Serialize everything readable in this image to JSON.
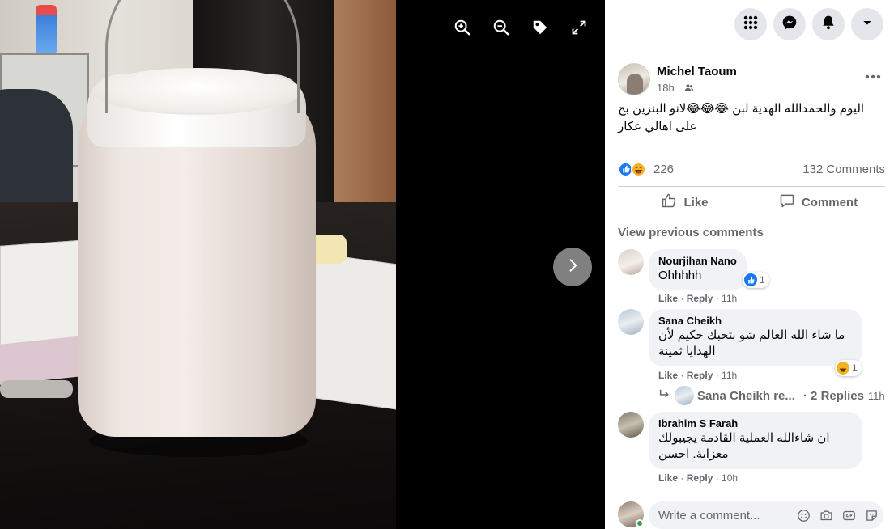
{
  "viewer": {
    "tools": [
      "zoom-in-icon",
      "zoom-out-icon",
      "tag-icon",
      "fullscreen-icon"
    ],
    "next_icon": "chevron-right-icon"
  },
  "topbar": {
    "buttons": [
      "menu-grid-icon",
      "messenger-icon",
      "notifications-bell-icon",
      "account-dropdown-icon"
    ]
  },
  "post": {
    "author": "Michel Taoum",
    "time": "18h",
    "audience_icon": "friends-icon",
    "text": "اليوم والحمدالله الهدية لبن 😂😂😂لانو البنزين بح على اهالي عكار",
    "reaction_count": "226",
    "comments_count": "132 Comments",
    "like_label": "Like",
    "comment_label": "Comment"
  },
  "comments_section": {
    "view_previous": "View previous comments",
    "comments": [
      {
        "name": "Nourjihan Nano",
        "text": "Ohhhhh",
        "like": "Like",
        "reply": "Reply",
        "time": "11h",
        "reaction_count": "1",
        "reaction": "like"
      },
      {
        "name": "Sana Cheikh",
        "text": "ما شاء الله العالم شو بتحبك حكيم لأن الهدايا ثمينة",
        "like": "Like",
        "reply": "Reply",
        "time": "11h",
        "reaction_count": "1",
        "reaction": "haha"
      },
      {
        "name": "Ibrahim S Farah",
        "text": "ان شاءالله العملية القادمة يجيبولك معزاية. احسن",
        "like": "Like",
        "reply": "Reply",
        "time": "10h"
      }
    ],
    "replies": {
      "name": "Sana Cheikh re...",
      "count": "· 2 Replies",
      "time": "11h"
    }
  },
  "composer": {
    "placeholder": "Write a comment...",
    "tools": [
      "emoji-icon",
      "camera-icon",
      "gif-icon",
      "sticker-icon"
    ]
  },
  "colors": {
    "like_blue": "#1877f2",
    "haha_yellow": "#f7b125",
    "muted_text": "#65676b",
    "bubble_bg": "#f0f2f5"
  }
}
